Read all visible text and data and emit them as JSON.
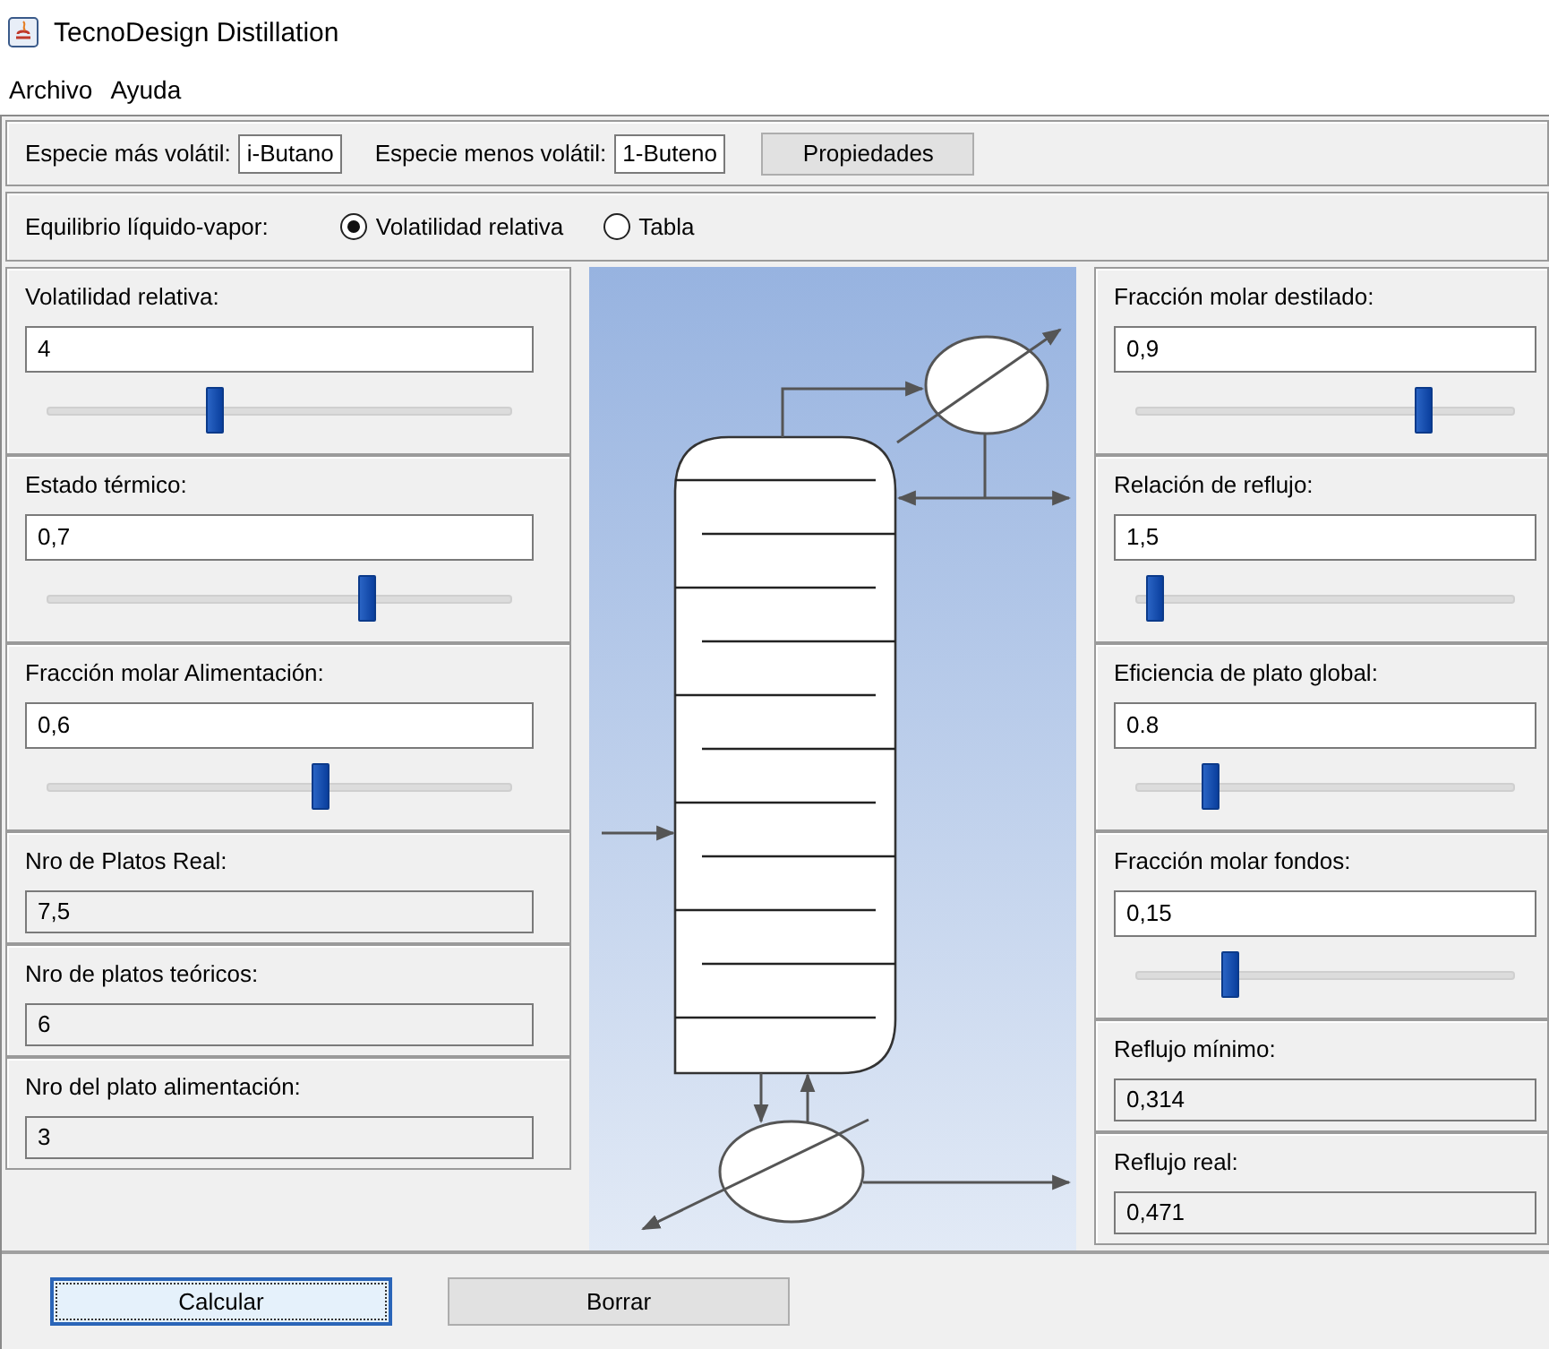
{
  "window": {
    "title": "TecnoDesign Distillation"
  },
  "menu": [
    "Archivo",
    "Ayuda"
  ],
  "species": [
    {
      "label": "Especie más volátil:",
      "value": "i-Butano"
    },
    {
      "label": "Especie menos volátil:",
      "value": "1-Buteno"
    }
  ],
  "properties_button": "Propiedades",
  "equilibrium": {
    "label": "Equilibrio líquido-vapor:",
    "options": [
      {
        "label": "Volatilidad relativa",
        "selected": true
      },
      {
        "label": "Tabla",
        "selected": false
      }
    ]
  },
  "left_panels": [
    {
      "kind": "slider",
      "label": "Volatilidad relativa:",
      "value": "4",
      "level": 0.36
    },
    {
      "kind": "slider",
      "label": "Estado térmico:",
      "value": "0,7",
      "level": 0.69
    },
    {
      "kind": "slider",
      "label": "Fracción molar Alimentación:",
      "value": "0,6",
      "level": 0.59
    },
    {
      "kind": "output",
      "label": "Nro de Platos Real:",
      "value": "7,5"
    },
    {
      "kind": "output",
      "label": "Nro de platos teóricos:",
      "value": "6"
    },
    {
      "kind": "output",
      "label": "Nro del plato alimentación:",
      "value": "3"
    }
  ],
  "right_panels": [
    {
      "kind": "slider",
      "label": "Fracción molar destilado:",
      "value": "0,9",
      "level": 0.76
    },
    {
      "kind": "slider",
      "label": "Relación de reflujo:",
      "value": "1,5",
      "level": 0.05
    },
    {
      "kind": "slider",
      "label": "Eficiencia de plato global:",
      "value": "0.8",
      "level": 0.2
    },
    {
      "kind": "slider",
      "label": "Fracción molar fondos:",
      "value": "0,15",
      "level": 0.25
    },
    {
      "kind": "output",
      "label": "Reflujo mínimo:",
      "value": "0,314"
    },
    {
      "kind": "output",
      "label": "Reflujo real:",
      "value": "0,471"
    }
  ],
  "buttons": [
    {
      "label": "Calcular",
      "focused": true
    },
    {
      "label": "Borrar",
      "focused": false
    }
  ]
}
